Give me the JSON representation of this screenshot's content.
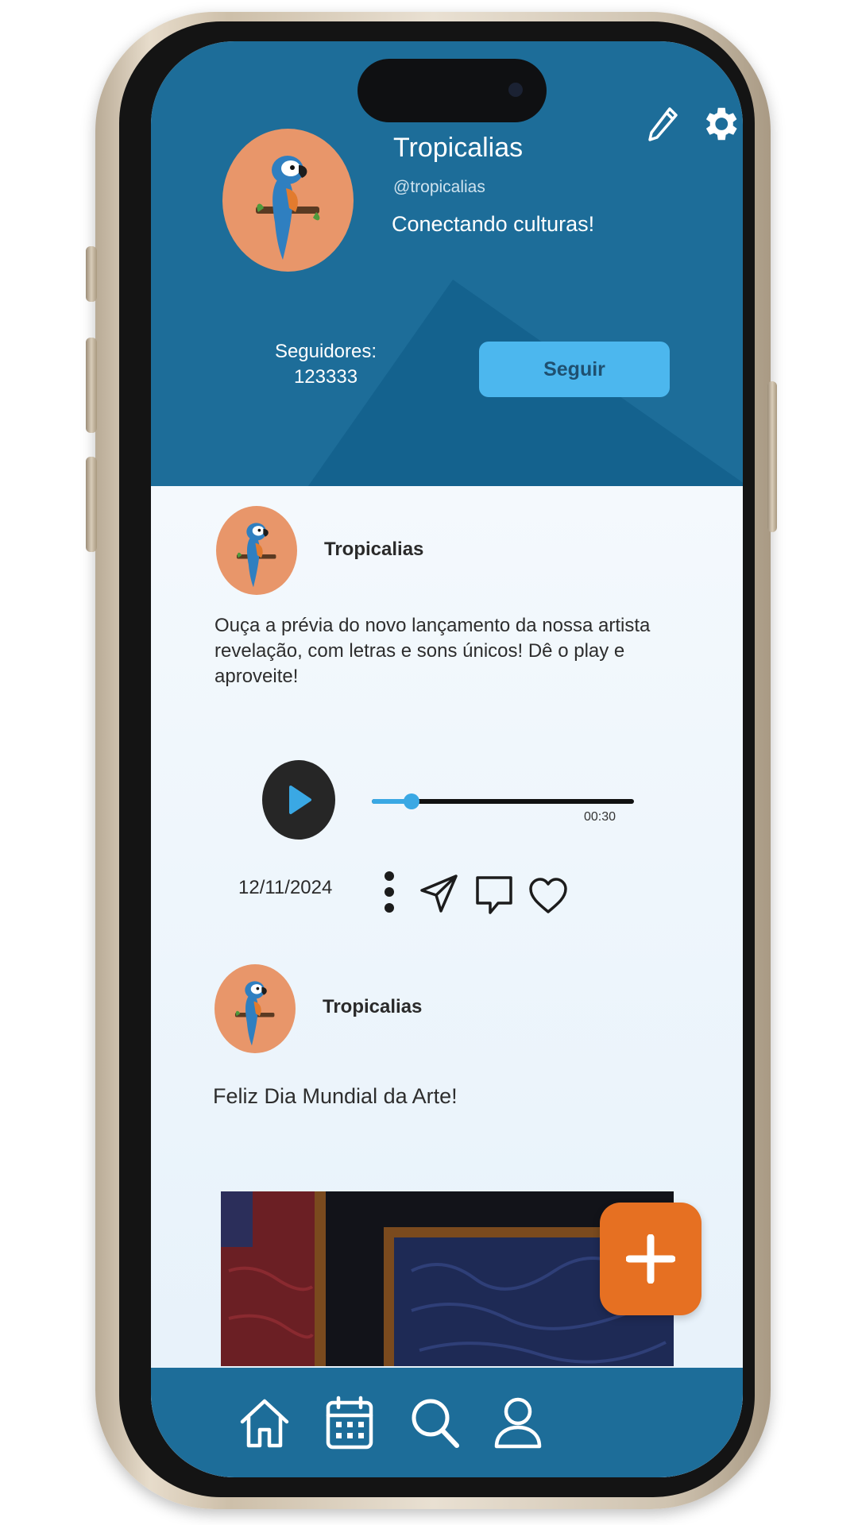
{
  "profile": {
    "name": "Tropicalias",
    "handle": "@tropicalias",
    "bio": "Conectando culturas!",
    "followers_label": "Seguidores:",
    "followers_count": "123333",
    "follow_button": "Seguir"
  },
  "header_icons": [
    "pencil-icon",
    "gear-icon"
  ],
  "posts": [
    {
      "author": "Tropicalias",
      "text": "Ouça a prévia do novo lançamento da nossa artista revelação, com letras e sons únicos! Dê o play e aproveite!",
      "audio": {
        "time": "00:30",
        "progress": 0.15
      },
      "date": "12/11/2024",
      "actions": [
        "more-icon",
        "send-icon",
        "comment-icon",
        "heart-icon"
      ]
    },
    {
      "author": "Tropicalias",
      "text": "Feliz Dia Mundial da Arte!"
    }
  ],
  "fab_icon": "plus-icon",
  "bottom_nav": [
    "home-icon",
    "calendar-icon",
    "search-icon",
    "profile-icon"
  ],
  "colors": {
    "header": "#1d6d99",
    "follow_button": "#4cb7ee",
    "avatar": "#e8966a",
    "fab": "#e67022",
    "progress": "#3aa8e4"
  }
}
